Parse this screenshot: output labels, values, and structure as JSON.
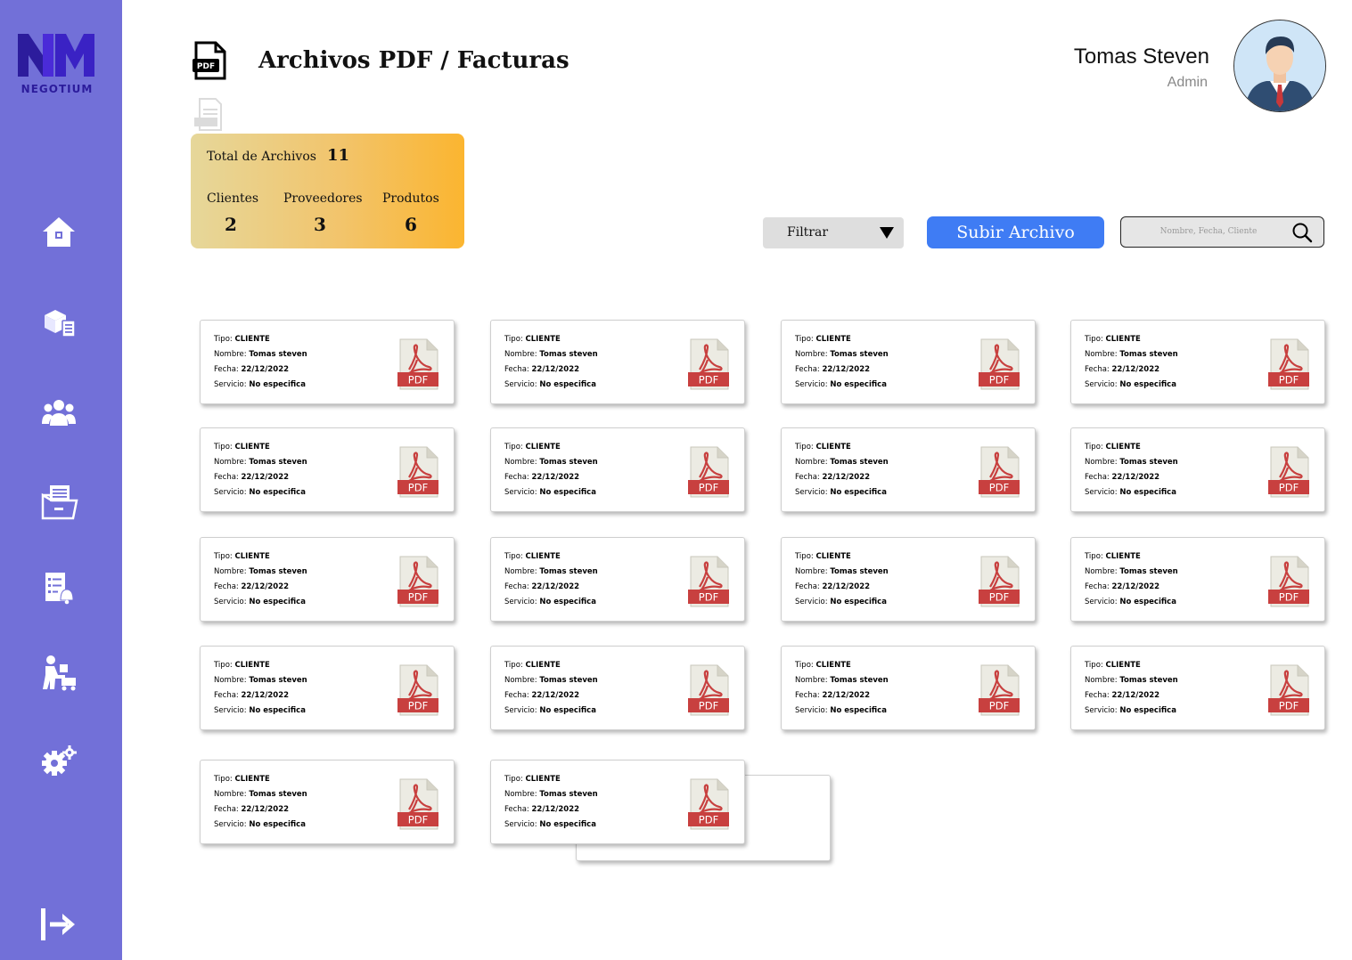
{
  "brand": {
    "name": "NEGOTIUM",
    "logo_letters": "NM"
  },
  "header": {
    "title": "Archivos PDF / Facturas",
    "title_icon": "pdf-file-icon",
    "user": {
      "name": "Tomas Steven",
      "role": "Admin"
    }
  },
  "sidebar": {
    "items": [
      {
        "name": "home",
        "icon": "home-icon"
      },
      {
        "name": "inventory",
        "icon": "boxes-checklist-icon"
      },
      {
        "name": "users",
        "icon": "users-group-icon"
      },
      {
        "name": "files",
        "icon": "folder-documents-icon"
      },
      {
        "name": "tasks",
        "icon": "checklist-bell-icon"
      },
      {
        "name": "providers",
        "icon": "delivery-person-icon"
      },
      {
        "name": "settings",
        "icon": "gears-icon"
      }
    ],
    "logout_icon": "logout-icon"
  },
  "stats": {
    "total_label": "Total de Archivos",
    "total_value": "11",
    "clientes_label": "Clientes",
    "clientes_value": "2",
    "proveedores_label": "Proveedores",
    "proveedores_value": "3",
    "produtos_label": "Produtos",
    "produtos_value": "6"
  },
  "toolbar": {
    "filter_label": "Filtrar",
    "upload_label": "Subir Archivo",
    "search_placeholder": "Nombre, Fecha, Cliente"
  },
  "files": [
    {
      "tipo_label": "Tipo:",
      "tipo": "CLIENTE",
      "nombre_label": "Nombre:",
      "nombre": "Tomas steven",
      "fecha_label": "Fecha:",
      "fecha": "22/12/2022",
      "servicio_label": "Servicio:",
      "servicio": "No especifica",
      "badge": "PDF"
    },
    {
      "tipo_label": "Tipo:",
      "tipo": "CLIENTE",
      "nombre_label": "Nombre:",
      "nombre": "Tomas steven",
      "fecha_label": "Fecha:",
      "fecha": "22/12/2022",
      "servicio_label": "Servicio:",
      "servicio": "No especifica",
      "badge": "PDF"
    },
    {
      "tipo_label": "Tipo:",
      "tipo": "CLIENTE",
      "nombre_label": "Nombre:",
      "nombre": "Tomas steven",
      "fecha_label": "Fecha:",
      "fecha": "22/12/2022",
      "servicio_label": "Servicio:",
      "servicio": "No especifica",
      "badge": "PDF"
    },
    {
      "tipo_label": "Tipo:",
      "tipo": "CLIENTE",
      "nombre_label": "Nombre:",
      "nombre": "Tomas steven",
      "fecha_label": "Fecha:",
      "fecha": "22/12/2022",
      "servicio_label": "Servicio:",
      "servicio": "No especifica",
      "badge": "PDF"
    },
    {
      "tipo_label": "Tipo:",
      "tipo": "CLIENTE",
      "nombre_label": "Nombre:",
      "nombre": "Tomas steven",
      "fecha_label": "Fecha:",
      "fecha": "22/12/2022",
      "servicio_label": "Servicio:",
      "servicio": "No especifica",
      "badge": "PDF"
    },
    {
      "tipo_label": "Tipo:",
      "tipo": "CLIENTE",
      "nombre_label": "Nombre:",
      "nombre": "Tomas steven",
      "fecha_label": "Fecha:",
      "fecha": "22/12/2022",
      "servicio_label": "Servicio:",
      "servicio": "No especifica",
      "badge": "PDF"
    },
    {
      "tipo_label": "Tipo:",
      "tipo": "CLIENTE",
      "nombre_label": "Nombre:",
      "nombre": "Tomas steven",
      "fecha_label": "Fecha:",
      "fecha": "22/12/2022",
      "servicio_label": "Servicio:",
      "servicio": "No especifica",
      "badge": "PDF"
    },
    {
      "tipo_label": "Tipo:",
      "tipo": "CLIENTE",
      "nombre_label": "Nombre:",
      "nombre": "Tomas steven",
      "fecha_label": "Fecha:",
      "fecha": "22/12/2022",
      "servicio_label": "Servicio:",
      "servicio": "No especifica",
      "badge": "PDF"
    },
    {
      "tipo_label": "Tipo:",
      "tipo": "CLIENTE",
      "nombre_label": "Nombre:",
      "nombre": "Tomas steven",
      "fecha_label": "Fecha:",
      "fecha": "22/12/2022",
      "servicio_label": "Servicio:",
      "servicio": "No especifica",
      "badge": "PDF"
    },
    {
      "tipo_label": "Tipo:",
      "tipo": "CLIENTE",
      "nombre_label": "Nombre:",
      "nombre": "Tomas steven",
      "fecha_label": "Fecha:",
      "fecha": "22/12/2022",
      "servicio_label": "Servicio:",
      "servicio": "No especifica",
      "badge": "PDF"
    },
    {
      "tipo_label": "Tipo:",
      "tipo": "CLIENTE",
      "nombre_label": "Nombre:",
      "nombre": "Tomas steven",
      "fecha_label": "Fecha:",
      "fecha": "22/12/2022",
      "servicio_label": "Servicio:",
      "servicio": "No especifica",
      "badge": "PDF"
    },
    {
      "tipo_label": "Tipo:",
      "tipo": "CLIENTE",
      "nombre_label": "Nombre:",
      "nombre": "Tomas steven",
      "fecha_label": "Fecha:",
      "fecha": "22/12/2022",
      "servicio_label": "Servicio:",
      "servicio": "No especifica",
      "badge": "PDF"
    },
    {
      "tipo_label": "Tipo:",
      "tipo": "CLIENTE",
      "nombre_label": "Nombre:",
      "nombre": "Tomas steven",
      "fecha_label": "Fecha:",
      "fecha": "22/12/2022",
      "servicio_label": "Servicio:",
      "servicio": "No especifica",
      "badge": "PDF"
    },
    {
      "tipo_label": "Tipo:",
      "tipo": "CLIENTE",
      "nombre_label": "Nombre:",
      "nombre": "Tomas steven",
      "fecha_label": "Fecha:",
      "fecha": "22/12/2022",
      "servicio_label": "Servicio:",
      "servicio": "No especifica",
      "badge": "PDF"
    },
    {
      "tipo_label": "Tipo:",
      "tipo": "CLIENTE",
      "nombre_label": "Nombre:",
      "nombre": "Tomas steven",
      "fecha_label": "Fecha:",
      "fecha": "22/12/2022",
      "servicio_label": "Servicio:",
      "servicio": "No especifica",
      "badge": "PDF"
    },
    {
      "tipo_label": "Tipo:",
      "tipo": "CLIENTE",
      "nombre_label": "Nombre:",
      "nombre": "Tomas steven",
      "fecha_label": "Fecha:",
      "fecha": "22/12/2022",
      "servicio_label": "Servicio:",
      "servicio": "No especifica",
      "badge": "PDF"
    },
    {
      "tipo_label": "Tipo:",
      "tipo": "CLIENTE",
      "nombre_label": "Nombre:",
      "nombre": "Tomas steven",
      "fecha_label": "Fecha:",
      "fecha": "22/12/2022",
      "servicio_label": "Servicio:",
      "servicio": "No especifica",
      "badge": "PDF"
    },
    {
      "tipo_label": "Tipo:",
      "tipo": "CLIENTE",
      "nombre_label": "Nombre:",
      "nombre": "Tomas steven",
      "fecha_label": "Fecha:",
      "fecha": "22/12/2022",
      "servicio_label": "Servicio:",
      "servicio": "No especifica",
      "badge": "PDF"
    }
  ],
  "colors": {
    "sidebar": "#7270d8",
    "brand_dark": "#2c1c9c",
    "upload_button": "#3f7cf4",
    "stats_gradient_start": "#e6d79a",
    "stats_gradient_end": "#fbb530",
    "pdf_red": "#c8403f"
  }
}
